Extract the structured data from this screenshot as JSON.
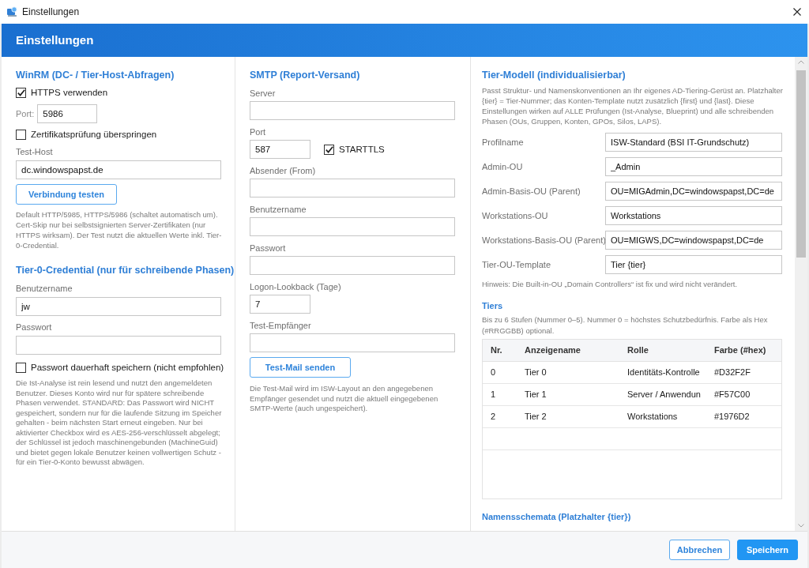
{
  "window": {
    "title": "Einstellungen"
  },
  "header": {
    "title": "Einstellungen"
  },
  "winrm": {
    "heading": "WinRM (DC- / Tier-Host-Abfragen)",
    "https": {
      "label": "HTTPS verwenden",
      "checked": true
    },
    "port": {
      "label": "Port:",
      "value": "5986"
    },
    "skip_cert": {
      "label": "Zertifikatsprüfung überspringen",
      "checked": false
    },
    "test_host": {
      "label": "Test-Host",
      "value": "dc.windowspapst.de"
    },
    "test_button": "Verbindung testen",
    "help": "Default HTTP/5985, HTTPS/5986 (schaltet automatisch um). Cert-Skip nur bei selbstsignierten Server-Zertifikaten (nur HTTPS wirksam). Der Test nutzt die aktuellen Werte inkl. Tier-0-Credential."
  },
  "credential": {
    "heading": "Tier-0-Credential (nur für schreibende Phasen)",
    "username": {
      "label": "Benutzername",
      "value": "jw"
    },
    "password": {
      "label": "Passwort"
    },
    "save_password": {
      "label": "Passwort dauerhaft speichern (nicht empfohlen)",
      "checked": false
    },
    "help": "Die Ist-Analyse ist rein lesend und nutzt den angemeldeten Benutzer. Dieses Konto wird nur für spätere schreibende Phasen verwendet. STANDARD: Das Passwort wird NICHT gespeichert, sondern nur für die laufende Sitzung im Speicher gehalten - beim nächsten Start erneut eingeben. Nur bei aktivierter Checkbox wird es AES-256-verschlüsselt abgelegt; der Schlüssel ist jedoch maschinengebunden (MachineGuid) und bietet gegen lokale Benutzer keinen vollwertigen Schutz - für ein Tier-0-Konto bewusst abwägen."
  },
  "smtp": {
    "heading": "SMTP (Report-Versand)",
    "fields": [
      {
        "label": "Server",
        "kind": "wide"
      },
      {
        "label": "Port",
        "value": "587",
        "kind": "narrow",
        "checkbox": {
          "label": "STARTTLS",
          "checked": true
        }
      },
      {
        "label": "Absender (From)",
        "kind": "wide"
      },
      {
        "label": "Benutzername",
        "kind": "wide"
      },
      {
        "label": "Passwort",
        "kind": "wide"
      },
      {
        "label": "Logon-Lookback (Tage)",
        "value": "7",
        "kind": "narrow"
      },
      {
        "label": "Test-Empfänger",
        "kind": "wide"
      }
    ],
    "test_button": "Test-Mail senden",
    "help": "Die Test-Mail wird im ISW-Layout an den angegebenen Empfänger gesendet und nutzt die aktuell eingegebenen SMTP-Werte (auch ungespeichert)."
  },
  "tier_model": {
    "heading": "Tier-Modell (individualisierbar)",
    "description": "Passt Struktur- und Namenskonventionen an Ihr eigenes AD-Tiering-Gerüst an. Platzhalter {tier} = Tier-Nummer; das Konten-Template nutzt zusätzlich {first} und {last}. Diese Einstellungen wirken auf ALLE Prüfungen (Ist-Analyse, Blueprint) und alle schreibenden Phasen (OUs, Gruppen, Konten, GPOs, Silos, LAPS).",
    "fields": [
      {
        "label": "Profilname",
        "value": "ISW-Standard (BSI IT-Grundschutz)"
      },
      {
        "label": "Admin-OU",
        "value": "_Admin"
      },
      {
        "label": "Admin-Basis-OU (Parent)",
        "value": "OU=MIGAdmin,DC=windowspapst,DC=de"
      },
      {
        "label": "Workstations-OU",
        "value": "Workstations"
      },
      {
        "label": "Workstations-Basis-OU (Parent)",
        "value": "OU=MIGWS,DC=windowspapst,DC=de"
      },
      {
        "label": "Tier-OU-Template",
        "value": "Tier {tier}"
      }
    ],
    "note": "Hinweis: Die Built-in-OU „Domain Controllers“ ist fix und wird nicht verändert.",
    "tiers": {
      "heading": "Tiers",
      "description": "Bis zu 6 Stufen (Nummer 0–5). Nummer 0 = höchstes Schutzbedürfnis. Farbe als Hex (#RRGGBB) optional.",
      "columns": [
        "Nr.",
        "Anzeigename",
        "Rolle",
        "Farbe (#hex)"
      ],
      "rows": [
        [
          "0",
          "Tier 0",
          "Identitäts-Kontrolle",
          "#D32F2F"
        ],
        [
          "1",
          "Tier 1",
          "Server / Anwendun",
          "#F57C00"
        ],
        [
          "2",
          "Tier 2",
          "Workstations",
          "#1976D2"
        ]
      ]
    },
    "naming_heading": "Namensschemata (Platzhalter {tier})"
  },
  "footer": {
    "buttons": [
      {
        "label": "Abbrechen",
        "kind": "secondary"
      },
      {
        "label": "Speichern",
        "kind": "primary"
      }
    ]
  }
}
